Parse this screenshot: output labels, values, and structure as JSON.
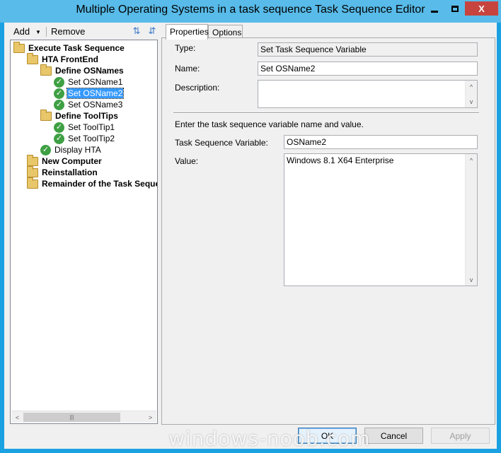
{
  "window": {
    "title": "Multiple Operating Systems in a task sequence Task Sequence Editor",
    "min_icon": "minimize-icon",
    "max_icon": "maximize-icon",
    "close_glyph": "X"
  },
  "toolbar": {
    "add_label": "Add",
    "add_arrow": "▼",
    "remove_label": "Remove",
    "up_glyph": "⇅",
    "down_glyph": "⇵"
  },
  "tree": {
    "items": [
      {
        "label": "Execute Task Sequence",
        "icon": "folder-icon",
        "bold": true,
        "level": 0
      },
      {
        "label": "HTA FrontEnd",
        "icon": "folder-icon",
        "bold": true,
        "level": 1
      },
      {
        "label": "Define OSNames",
        "icon": "folder-icon",
        "bold": true,
        "level": 2
      },
      {
        "label": "Set OSName1",
        "icon": "check-icon",
        "bold": false,
        "level": 3
      },
      {
        "label": "Set OSName2",
        "icon": "check-icon",
        "bold": false,
        "level": 3,
        "selected": true
      },
      {
        "label": "Set OSName3",
        "icon": "check-icon",
        "bold": false,
        "level": 3
      },
      {
        "label": "Define ToolTips",
        "icon": "folder-icon",
        "bold": true,
        "level": 2
      },
      {
        "label": "Set ToolTip1",
        "icon": "check-icon",
        "bold": false,
        "level": 3
      },
      {
        "label": "Set ToolTip2",
        "icon": "check-icon",
        "bold": false,
        "level": 3
      },
      {
        "label": "Display HTA",
        "icon": "check-icon",
        "bold": false,
        "level": 2
      },
      {
        "label": "New Computer",
        "icon": "folder-icon",
        "bold": true,
        "level": 1
      },
      {
        "label": "Reinstallation",
        "icon": "folder-icon",
        "bold": true,
        "level": 1
      },
      {
        "label": "Remainder of the Task Sequence",
        "icon": "folder-icon",
        "bold": true,
        "level": 1
      }
    ],
    "check_glyph": "✓"
  },
  "scroll": {
    "left_glyph": "<",
    "right_glyph": ">",
    "up_glyph": "^",
    "down_glyph": "v",
    "grip_glyph": "|||"
  },
  "tabs": [
    {
      "label": "Properties",
      "active": true
    },
    {
      "label": "Options",
      "active": false
    }
  ],
  "properties": {
    "type_label": "Type:",
    "type_value": "Set Task Sequence Variable",
    "name_label": "Name:",
    "name_value": "Set OSName2",
    "description_label": "Description:",
    "description_value": "",
    "instruction": "Enter the task sequence variable name and value.",
    "variable_label": "Task Sequence Variable:",
    "variable_value": "OSName2",
    "value_label": "Value:",
    "value_value": "Windows 8.1 X64 Enterprise"
  },
  "buttons": {
    "ok": "OK",
    "cancel": "Cancel",
    "apply": "Apply"
  },
  "watermark": "windows-noob.com"
}
